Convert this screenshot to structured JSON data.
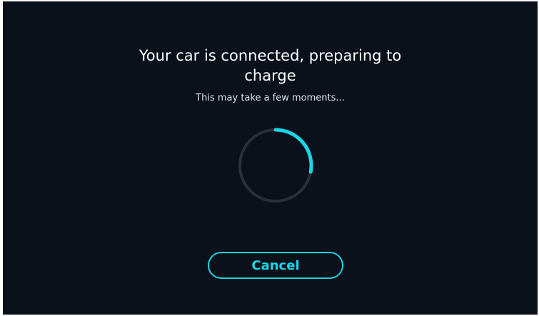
{
  "status": {
    "title_line1": "Your car is connected, preparing to",
    "title_line2": "charge",
    "subtitle": "This may take a few moments..."
  },
  "spinner": {
    "icon": "loading-spinner-icon",
    "track_color": "#2a2f38",
    "arc_color": "#19d6e6"
  },
  "actions": {
    "cancel_label": "Cancel"
  },
  "colors": {
    "background": "#0a111a",
    "accent": "#19d6e6",
    "text": "#ffffff"
  }
}
